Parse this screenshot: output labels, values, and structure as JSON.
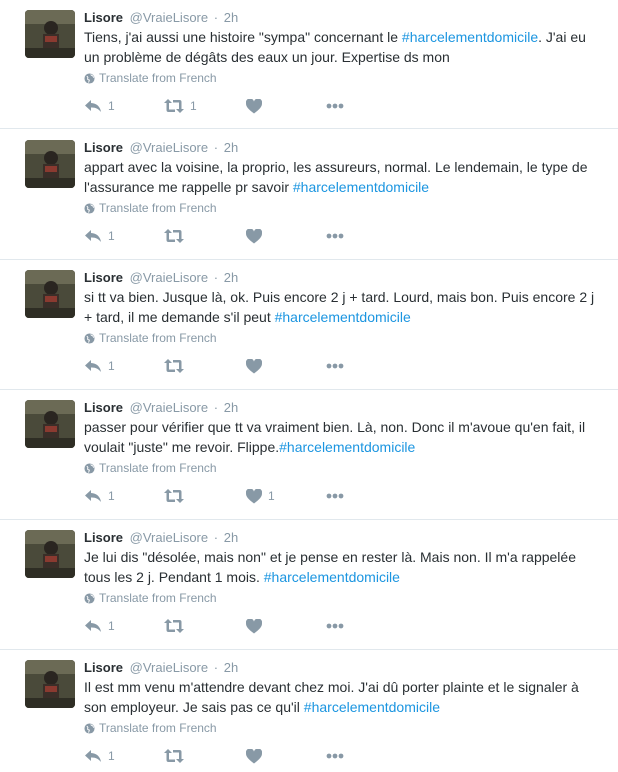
{
  "colors": {
    "hashtag": "#1b95e0",
    "muted": "#8899a6",
    "text": "#292f33",
    "divider": "#e1e8ed"
  },
  "icons": {
    "reply": "reply-arrow-icon",
    "retweet": "retweet-icon",
    "like": "heart-icon",
    "more": "more-dots-icon",
    "translate": "globe-icon"
  },
  "tweets": [
    {
      "author_name": "Lisore",
      "author_handle": "@VraieLisore",
      "separator": "·",
      "time": "2h",
      "text_before": "Tiens, j'ai aussi une histoire \"sympa\" concernant le ",
      "hashtag": "#harcelementdomicile",
      "text_after": ". J'ai eu un problème de dégâts des eaux un jour. Expertise ds mon",
      "translate_label": "Translate from French",
      "reply_count": "1",
      "retweet_count": "1",
      "like_count": ""
    },
    {
      "author_name": "Lisore",
      "author_handle": "@VraieLisore",
      "separator": "·",
      "time": "2h",
      "text_before": "appart avec la voisine, la proprio, les assureurs, normal. Le lendemain, le type de l'assurance me rappelle pr savoir ",
      "hashtag": "#harcelementdomicile",
      "text_after": "",
      "translate_label": "Translate from French",
      "reply_count": "1",
      "retweet_count": "",
      "like_count": ""
    },
    {
      "author_name": "Lisore",
      "author_handle": "@VraieLisore",
      "separator": "·",
      "time": "2h",
      "text_before": "si tt va bien. Jusque là, ok. Puis encore 2 j + tard. Lourd, mais bon. Puis encore 2 j + tard, il me demande s'il peut ",
      "hashtag": "#harcelementdomicile",
      "text_after": "",
      "translate_label": "Translate from French",
      "reply_count": "1",
      "retweet_count": "",
      "like_count": ""
    },
    {
      "author_name": "Lisore",
      "author_handle": "@VraieLisore",
      "separator": "·",
      "time": "2h",
      "text_before": "passer pour vérifier que tt va vraiment bien. Là, non. Donc il m'avoue qu'en fait, il voulait \"juste\" me revoir. Flippe.",
      "hashtag": "#harcelementdomicile",
      "text_after": "",
      "translate_label": "Translate from French",
      "reply_count": "1",
      "retweet_count": "",
      "like_count": "1"
    },
    {
      "author_name": "Lisore",
      "author_handle": "@VraieLisore",
      "separator": "·",
      "time": "2h",
      "text_before": "Je lui dis \"désolée, mais non\" et je pense en rester là. Mais non. Il m'a rappelée tous les 2 j. Pendant 1 mois. ",
      "hashtag": "#harcelementdomicile",
      "text_after": "",
      "translate_label": "Translate from French",
      "reply_count": "1",
      "retweet_count": "",
      "like_count": ""
    },
    {
      "author_name": "Lisore",
      "author_handle": "@VraieLisore",
      "separator": "·",
      "time": "2h",
      "text_before": "Il est mm venu m'attendre devant chez moi. J'ai dû porter plainte et le signaler à son employeur.  Je sais pas ce qu'il ",
      "hashtag": "#harcelementdomicile",
      "text_after": "",
      "translate_label": "Translate from French",
      "reply_count": "1",
      "retweet_count": "",
      "like_count": ""
    }
  ]
}
